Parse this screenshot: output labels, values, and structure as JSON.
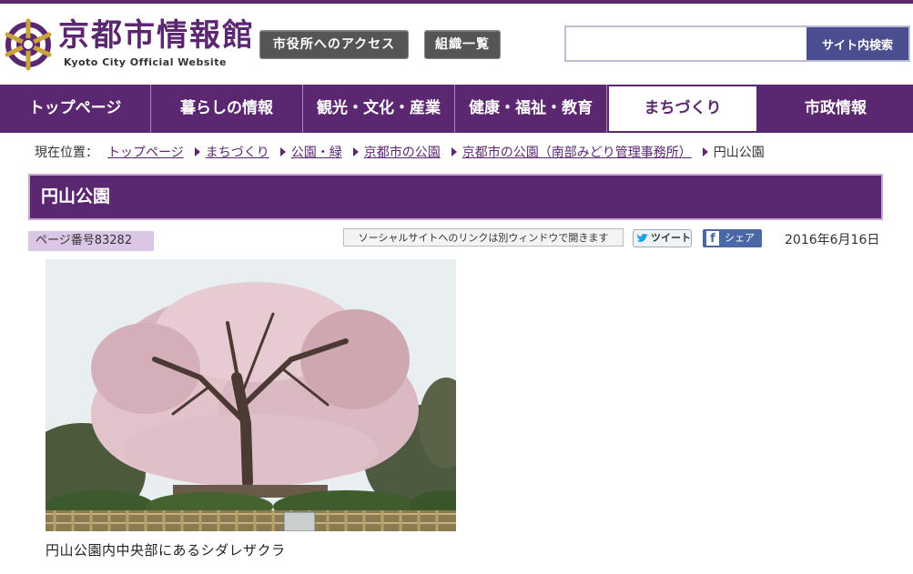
{
  "header": {
    "site_title": "京都市情報館",
    "site_subtitle": "Kyoto City Official Website",
    "access_button": "市役所へのアクセス",
    "org_button": "組織一覧",
    "search": {
      "placeholder": "",
      "button_label": "サイト内検索"
    }
  },
  "nav": {
    "items": [
      {
        "label": "トップページ",
        "active": false
      },
      {
        "label": "暮らしの情報",
        "active": false
      },
      {
        "label": "観光・文化・産業",
        "active": false
      },
      {
        "label": "健康・福祉・教育",
        "active": false
      },
      {
        "label": "まちづくり",
        "active": true
      },
      {
        "label": "市政情報",
        "active": false
      }
    ]
  },
  "breadcrumb": {
    "label": "現在位置：",
    "links": [
      "トップページ",
      "まちづくり",
      "公園・緑",
      "京都市の公園",
      "京都市の公園（南部みどり管理事務所）"
    ],
    "current": "円山公園"
  },
  "page": {
    "title": "円山公園",
    "number": "ページ番号83282",
    "social_note": "ソーシャルサイトへのリンクは別ウィンドウで開きます",
    "tweet_label": "ツイート",
    "share_label": "シェア",
    "date": "2016年6月16日"
  },
  "photo": {
    "caption": "円山公園内中央部にあるシダレザクラ"
  },
  "colors": {
    "brand_purple": "#5b2770",
    "light_purple": "#dcc6e6",
    "search_button": "#4a4d8f",
    "facebook_blue": "#4a67a8"
  }
}
